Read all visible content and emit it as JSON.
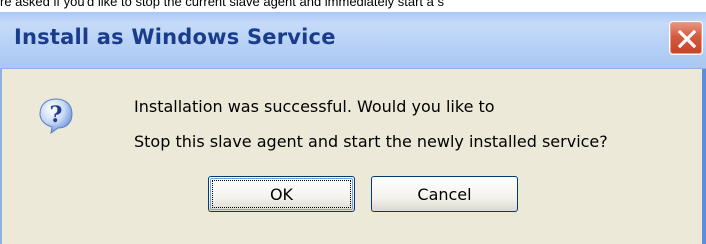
{
  "background_text": "re asked if you'd like to stop the current slave agent and immediately start a s",
  "dialog": {
    "title": "Install as Windows Service",
    "message_line1": "Installation was successful. Would you like to",
    "message_line2": "Stop this slave agent and start the newly installed service?",
    "icon": "question-icon",
    "buttons": {
      "ok_label": "OK",
      "cancel_label": "Cancel"
    }
  },
  "colors": {
    "title_text": "#1a3c8c",
    "titlebar": "#b8d2f6",
    "client_background": "#ece9d8",
    "close_button": "#d55b3f"
  }
}
